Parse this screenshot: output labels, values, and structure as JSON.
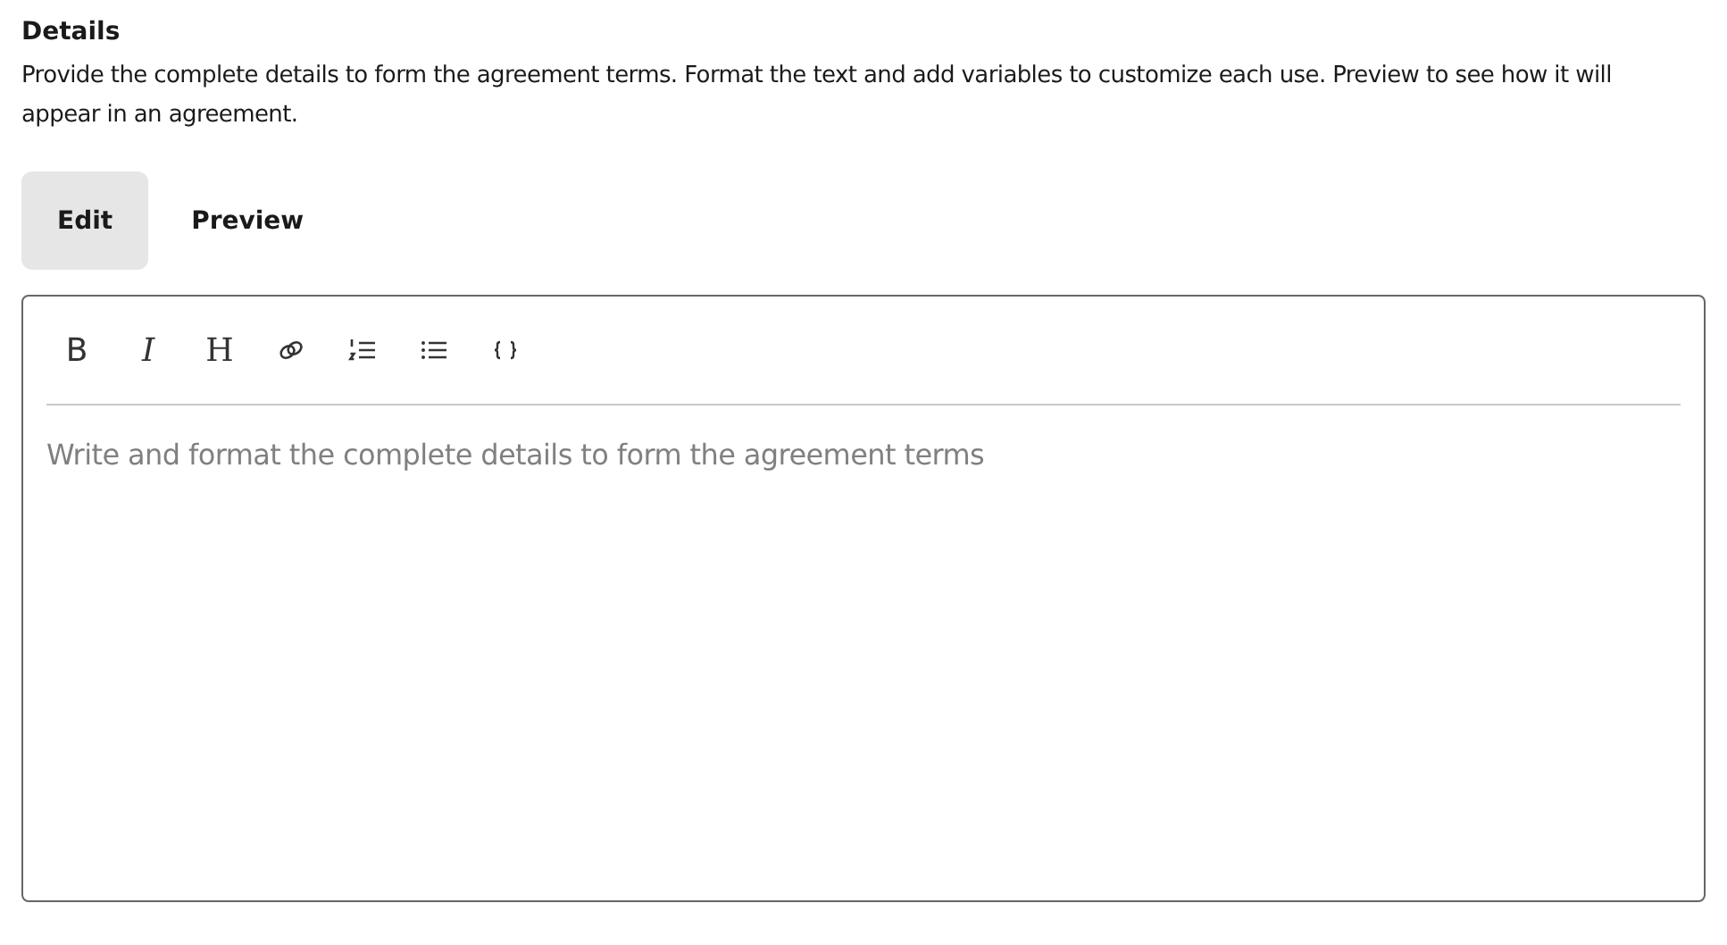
{
  "section": {
    "title": "Details",
    "description": "Provide the complete details to form the agreement terms. Format the text and add variables to customize each use. Preview to see how it will appear in an agreement."
  },
  "tabs": [
    {
      "label": "Edit",
      "selected": true
    },
    {
      "label": "Preview",
      "selected": false
    }
  ],
  "toolbar": [
    {
      "kind": "glyph",
      "label": "B"
    },
    {
      "kind": "glyph",
      "label": "I"
    },
    {
      "kind": "glyph",
      "label": "H"
    },
    {
      "kind": "link"
    },
    {
      "kind": "ordered"
    },
    {
      "kind": "bullet"
    },
    {
      "kind": "code"
    }
  ],
  "editor": {
    "placeholder": "Write and format the complete details to form the agreement terms"
  }
}
